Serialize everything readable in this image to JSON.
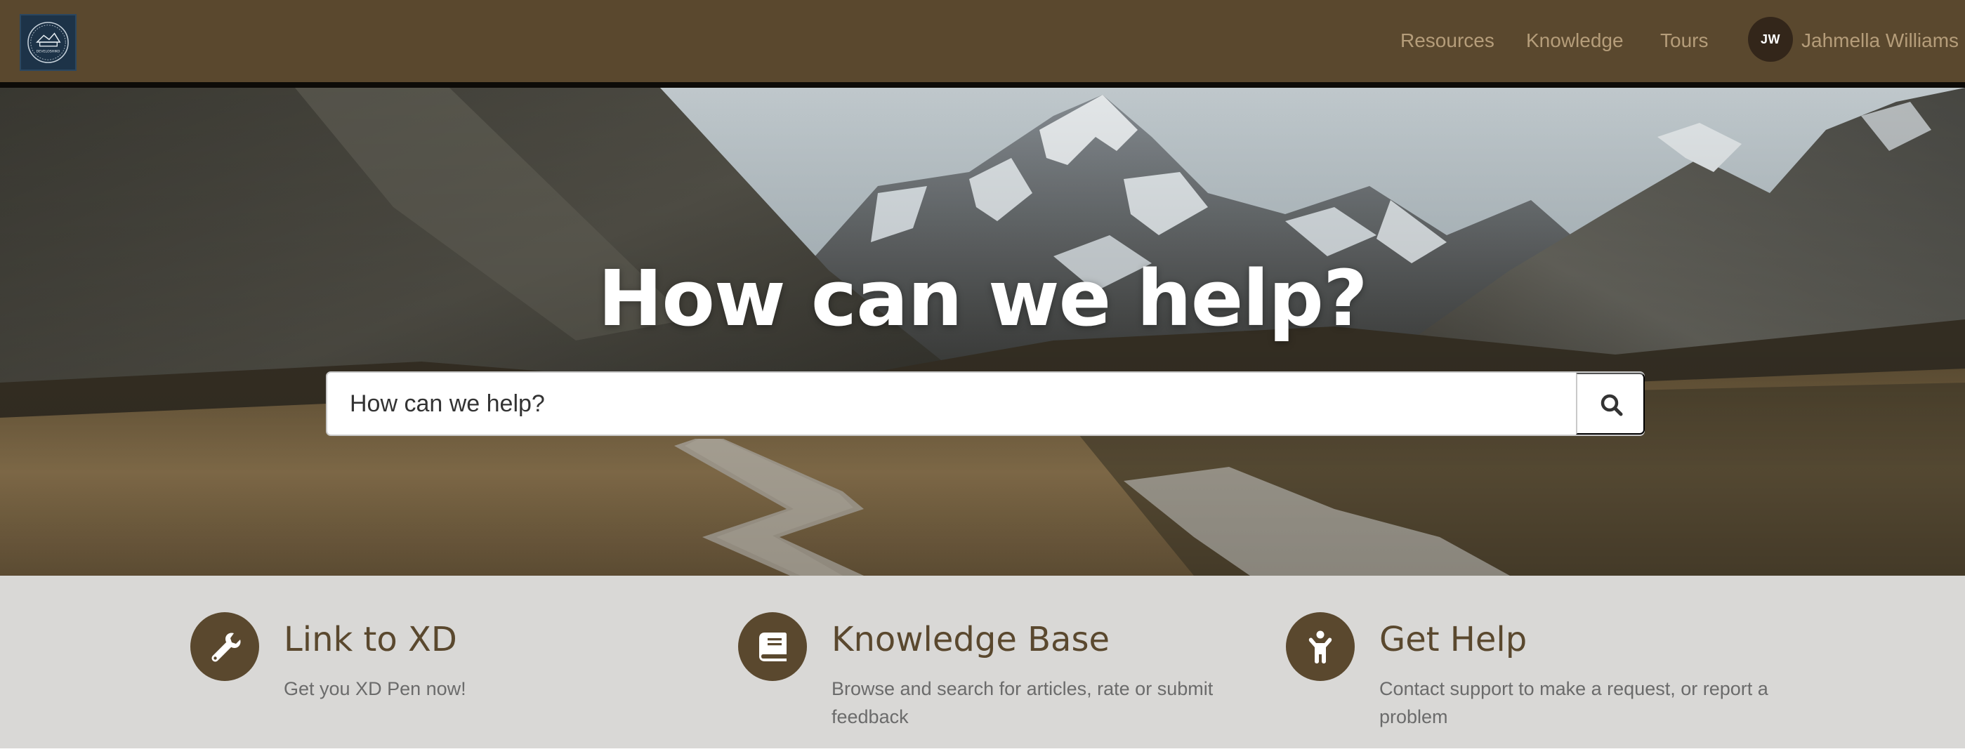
{
  "header": {
    "logo_icon": "company-logo-emblem",
    "logo_text": "DEVELOSHIKO",
    "nav": [
      "Resources",
      "Knowledge",
      "Tours"
    ],
    "user": {
      "initials": "JW",
      "name": "Jahmella Williams"
    }
  },
  "hero": {
    "title": "How can we help?",
    "search": {
      "placeholder": "How can we help?",
      "value": "",
      "button_icon": "search-icon"
    }
  },
  "features": [
    {
      "icon": "wrench-icon",
      "title": "Link to XD",
      "description": "Get you XD Pen now!"
    },
    {
      "icon": "book-icon",
      "title": "Knowledge Base",
      "description": "Browse and search for articles, rate or submit feedback"
    },
    {
      "icon": "person-icon",
      "title": "Get Help",
      "description": "Contact support to make a request, or report a problem"
    }
  ],
  "colors": {
    "header_bg": "#5a482e",
    "nav_text": "#b59d7a",
    "accent": "#5a482e",
    "strip_bg": "#d9d8d6"
  }
}
